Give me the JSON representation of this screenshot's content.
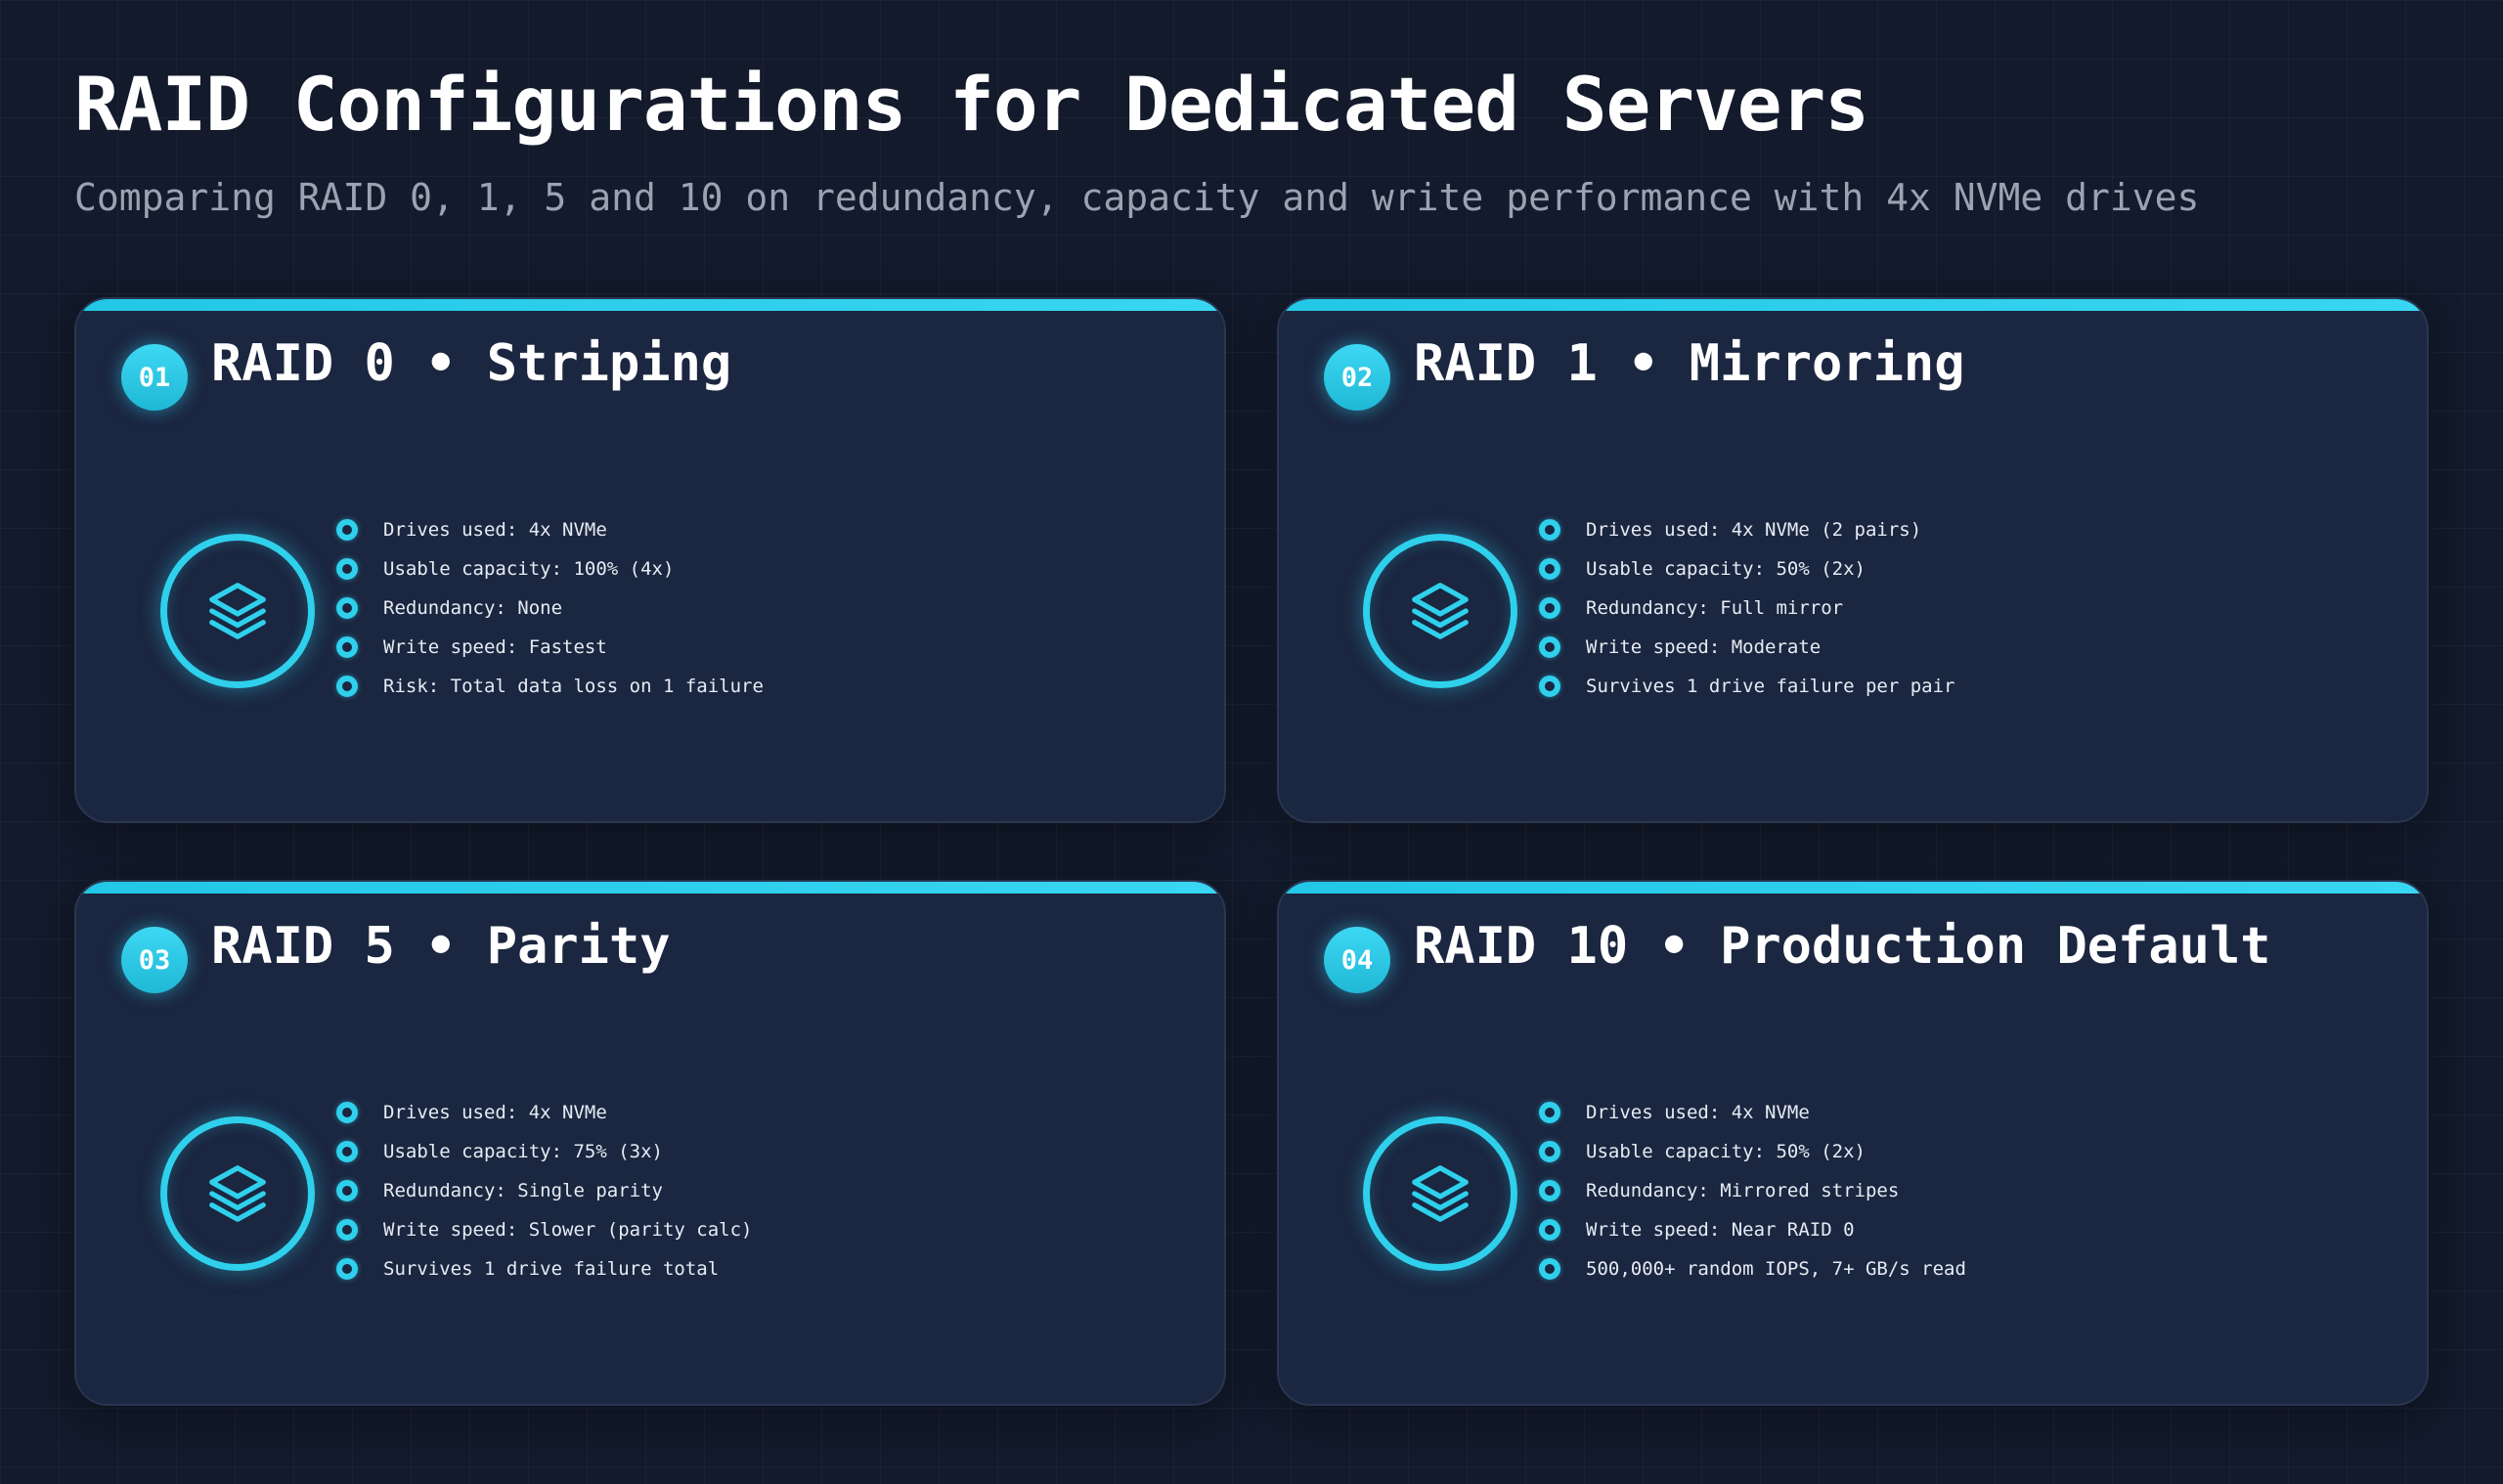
{
  "page": {
    "title": "RAID Configurations for Dedicated Servers",
    "subtitle": "Comparing RAID 0, 1, 5 and 10 on redundancy, capacity and write performance with 4x NVMe drives"
  },
  "colors": {
    "background": "#121a2b",
    "card": "#1b2640",
    "accent": "#2fd0ec"
  },
  "cards": [
    {
      "number": "01",
      "title": "RAID 0 • Striping",
      "icon": "layers-icon",
      "items": [
        "Drives used: 4x NVMe",
        "Usable capacity: 100% (4x)",
        "Redundancy: None",
        "Write speed: Fastest",
        "Risk: Total data loss on 1 failure"
      ]
    },
    {
      "number": "02",
      "title": "RAID 1 • Mirroring",
      "icon": "layers-icon",
      "items": [
        "Drives used: 4x NVMe (2 pairs)",
        "Usable capacity: 50% (2x)",
        "Redundancy: Full mirror",
        "Write speed: Moderate",
        "Survives 1 drive failure per pair"
      ]
    },
    {
      "number": "03",
      "title": "RAID 5 • Parity",
      "icon": "layers-icon",
      "items": [
        "Drives used: 4x NVMe",
        "Usable capacity: 75% (3x)",
        "Redundancy: Single parity",
        "Write speed: Slower (parity calc)",
        "Survives 1 drive failure total"
      ]
    },
    {
      "number": "04",
      "title": "RAID 10 • Production Default",
      "icon": "layers-icon",
      "items": [
        "Drives used: 4x NVMe",
        "Usable capacity: 50% (2x)",
        "Redundancy: Mirrored stripes",
        "Write speed: Near RAID 0",
        "500,000+ random IOPS, 7+ GB/s read"
      ]
    }
  ]
}
